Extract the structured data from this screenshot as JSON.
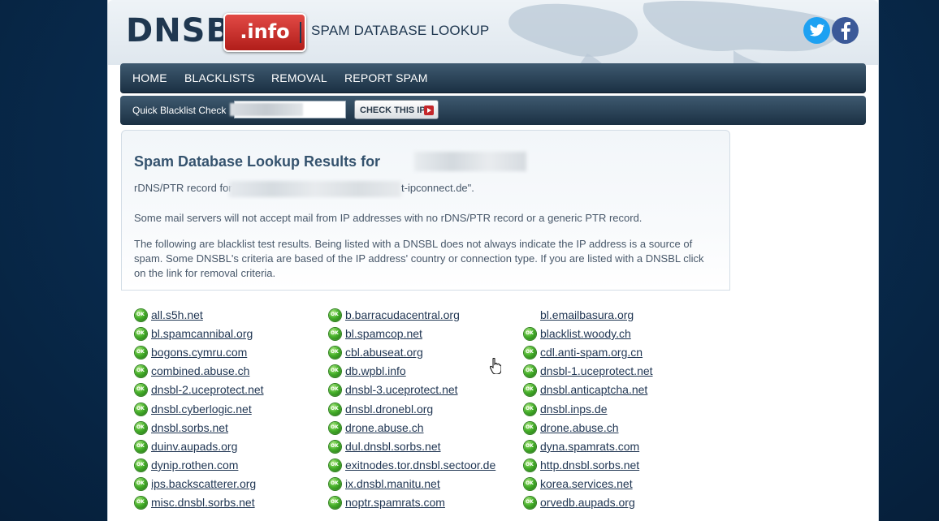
{
  "brand": {
    "logo_main": "DNSBL",
    "logo_badge": ".info",
    "tagline": "SPAM DATABASE LOOKUP"
  },
  "nav": {
    "items": [
      "HOME",
      "BLACKLISTS",
      "REMOVAL",
      "REPORT SPAM"
    ]
  },
  "quick_check": {
    "label": "Quick Blacklist Check",
    "input_value": "",
    "button_label": "CHECK THIS IP"
  },
  "results": {
    "title": "Spam Database Lookup Results for",
    "rdns_prefix": "rDNS/PTR record for",
    "rdns_suffix": "t-ipconnect.de\".",
    "notice": "Some mail servers will not accept mail from IP addresses with no rDNS/PTR record or a generic PTR record.",
    "intro": "The following are blacklist test results. Being listed with a DNSBL does not always indicate the IP address is a source of spam. Some DNSBL's criteria are based of the IP address' country or connection type. If you are listed with a DNSBL click on the link for removal criteria."
  },
  "blacklists": [
    [
      {
        "name": "all.s5h.net",
        "status": "ok"
      },
      {
        "name": "bl.spamcannibal.org",
        "status": "ok"
      },
      {
        "name": "bogons.cymru.com",
        "status": "ok"
      },
      {
        "name": "combined.abuse.ch",
        "status": "ok"
      },
      {
        "name": "dnsbl-2.uceprotect.net",
        "status": "ok"
      },
      {
        "name": "dnsbl.cyberlogic.net",
        "status": "ok"
      },
      {
        "name": "dnsbl.sorbs.net",
        "status": "ok"
      },
      {
        "name": "duinv.aupads.org",
        "status": "ok"
      },
      {
        "name": "dynip.rothen.com",
        "status": "ok"
      },
      {
        "name": "ips.backscatterer.org",
        "status": "ok"
      },
      {
        "name": "misc.dnsbl.sorbs.net",
        "status": "ok"
      }
    ],
    [
      {
        "name": "b.barracudacentral.org",
        "status": "ok"
      },
      {
        "name": "bl.spamcop.net",
        "status": "ok"
      },
      {
        "name": "cbl.abuseat.org",
        "status": "ok"
      },
      {
        "name": "db.wpbl.info",
        "status": "ok"
      },
      {
        "name": "dnsbl-3.uceprotect.net",
        "status": "ok"
      },
      {
        "name": "dnsbl.dronebl.org",
        "status": "ok"
      },
      {
        "name": "drone.abuse.ch",
        "status": "ok"
      },
      {
        "name": "dul.dnsbl.sorbs.net",
        "status": "ok"
      },
      {
        "name": "exitnodes.tor.dnsbl.sectoor.de",
        "status": "ok"
      },
      {
        "name": "ix.dnsbl.manitu.net",
        "status": "ok"
      },
      {
        "name": "noptr.spamrats.com",
        "status": "ok"
      }
    ],
    [
      {
        "name": "bl.emailbasura.org",
        "status": "none"
      },
      {
        "name": "blacklist.woody.ch",
        "status": "ok"
      },
      {
        "name": "cdl.anti-spam.org.cn",
        "status": "ok"
      },
      {
        "name": "dnsbl-1.uceprotect.net",
        "status": "ok"
      },
      {
        "name": "dnsbl.anticaptcha.net",
        "status": "ok"
      },
      {
        "name": "dnsbl.inps.de",
        "status": "ok"
      },
      {
        "name": "drone.abuse.ch",
        "status": "ok"
      },
      {
        "name": "dyna.spamrats.com",
        "status": "ok"
      },
      {
        "name": "http.dnsbl.sorbs.net",
        "status": "ok"
      },
      {
        "name": "korea.services.net",
        "status": "ok"
      },
      {
        "name": "orvedb.aupads.org",
        "status": "ok"
      }
    ]
  ]
}
